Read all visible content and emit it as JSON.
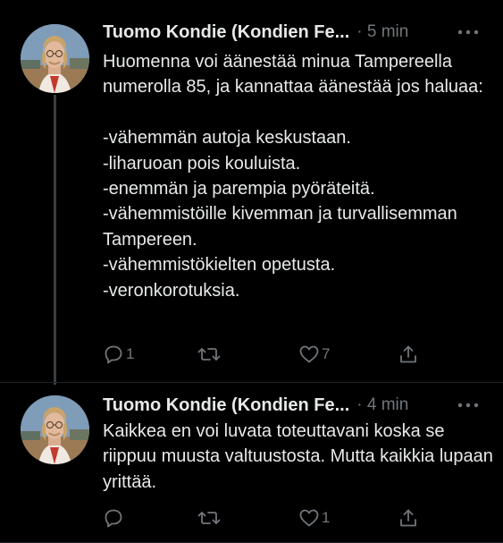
{
  "theme": {
    "background": "#000000",
    "text_primary": "#e7e9ea",
    "text_secondary": "#71767b",
    "thread_line": "#3b3e42"
  },
  "tweets": [
    {
      "author": "Tuomo Kondie (Kondien Fe...",
      "time": "· 5 min",
      "text": "Huomenna voi äänestää minua Tampereella numerolla 85, ja kannattaa äänestää jos haluaa:\n\n-vähemmän autoja keskustaan.\n-liharuoan pois kouluista.\n-enemmän ja parempia pyöräteitä.\n-vähemmistöille kivemman ja turvallisemman Tampereen.\n-vähemmistökielten opetusta.\n-veronkorotuksia.",
      "reply_count": "1",
      "retweet_count": "",
      "like_count": "7",
      "icons": [
        "reply-icon",
        "retweet-icon",
        "like-icon",
        "share-icon",
        "more-icon"
      ]
    },
    {
      "author": "Tuomo Kondie (Kondien Fe...",
      "time": "· 4 min",
      "text": "Kaikkea en voi luvata toteuttavani koska se riippuu muusta valtuustosta. Mutta kaikkia lupaan yrittää.",
      "reply_count": "",
      "retweet_count": "",
      "like_count": "1",
      "icons": [
        "reply-icon",
        "retweet-icon",
        "like-icon",
        "share-icon",
        "more-icon"
      ]
    }
  ]
}
